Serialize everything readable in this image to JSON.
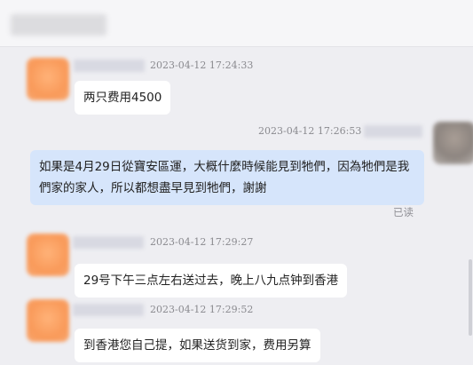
{
  "window": {
    "title": ""
  },
  "messages": [
    {
      "direction": "incoming",
      "timestamp": "2023-04-12 17:24:33",
      "text": "两只费用4500"
    },
    {
      "direction": "outgoing",
      "timestamp": "2023-04-12 17:26:53",
      "text": "如果是4月29日從寶安區運，大概什麼時候能見到牠們，因為牠們是我們家的家人，所以都想盡早見到牠們，謝謝",
      "status": "已读"
    },
    {
      "direction": "incoming",
      "timestamp": "2023-04-12 17:29:27",
      "text": "29号下午三点左右送过去，晚上八九点钟到香港"
    },
    {
      "direction": "incoming",
      "timestamp": "2023-04-12 17:29:52",
      "text": "到香港您自己提，如果送货到家，费用另算"
    }
  ]
}
